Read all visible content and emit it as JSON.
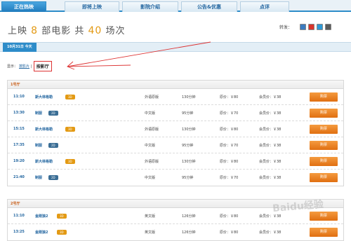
{
  "tabs": [
    {
      "label": "正在热映",
      "active": true
    },
    {
      "label": "即将上映",
      "active": false
    },
    {
      "label": "影院介绍",
      "active": false
    },
    {
      "label": "公告&优惠",
      "active": false
    },
    {
      "label": "点评",
      "active": false
    }
  ],
  "headline": {
    "prefix": "上映",
    "movie_count": "8",
    "middle": "部电影 共",
    "show_count": "40",
    "suffix": "场次"
  },
  "share": {
    "label": "转发：",
    "icons": [
      "share-icon-1",
      "share-icon-2",
      "share-icon-3",
      "share-icon-4"
    ]
  },
  "date_tab": "10月31日  今天",
  "filter": {
    "label": "显示：",
    "link": "按影片",
    "separator": "|",
    "highlight": "按影厅"
  },
  "halls": [
    {
      "name": "1号厅",
      "rows": [
        {
          "time": "11:10",
          "title": "斯大林格勒",
          "format": "3D",
          "lang": "外语原版",
          "duration": "130分钟",
          "price": "原价：￥80",
          "member": "会员价：￥38",
          "buy": "购票"
        },
        {
          "time": "13:30",
          "title": "制服",
          "format": "2D",
          "lang": "中文版",
          "duration": "95分钟",
          "price": "原价：￥70",
          "member": "会员价：￥38",
          "buy": "购票"
        },
        {
          "time": "15:15",
          "title": "斯大林格勒",
          "format": "3D",
          "lang": "外语原版",
          "duration": "130分钟",
          "price": "原价：￥80",
          "member": "会员价：￥38",
          "buy": "购票"
        },
        {
          "time": "17:35",
          "title": "制服",
          "format": "2D",
          "lang": "中文版",
          "duration": "95分钟",
          "price": "原价：￥70",
          "member": "会员价：￥38",
          "buy": "购票"
        },
        {
          "time": "19:20",
          "title": "斯大林格勒",
          "format": "3D",
          "lang": "外语原版",
          "duration": "130分钟",
          "price": "原价：￥80",
          "member": "会员价：￥38",
          "buy": "购票"
        },
        {
          "time": "21:40",
          "title": "制服",
          "format": "2D",
          "lang": "中文版",
          "duration": "95分钟",
          "price": "原价：￥70",
          "member": "会员价：￥38",
          "buy": "购票"
        }
      ]
    },
    {
      "name": "2号厅",
      "rows": [
        {
          "time": "11:10",
          "title": "金刚狼2",
          "format": "3D",
          "lang": "英文版",
          "duration": "126分钟",
          "price": "原价：￥80",
          "member": "会员价：￥38",
          "buy": "购票"
        },
        {
          "time": "13:25",
          "title": "金刚狼2",
          "format": "3D",
          "lang": "英文版",
          "duration": "126分钟",
          "price": "原价：￥80",
          "member": "会员价：￥38",
          "buy": "购票"
        }
      ]
    }
  ],
  "watermark": "Baidu经验",
  "colors": {
    "accent": "#2d8cc9",
    "highlight_number": "#e39a14",
    "buy_button": "#e06f11",
    "badge_3d": "#e39a14",
    "badge_2d": "#3b6e95"
  }
}
